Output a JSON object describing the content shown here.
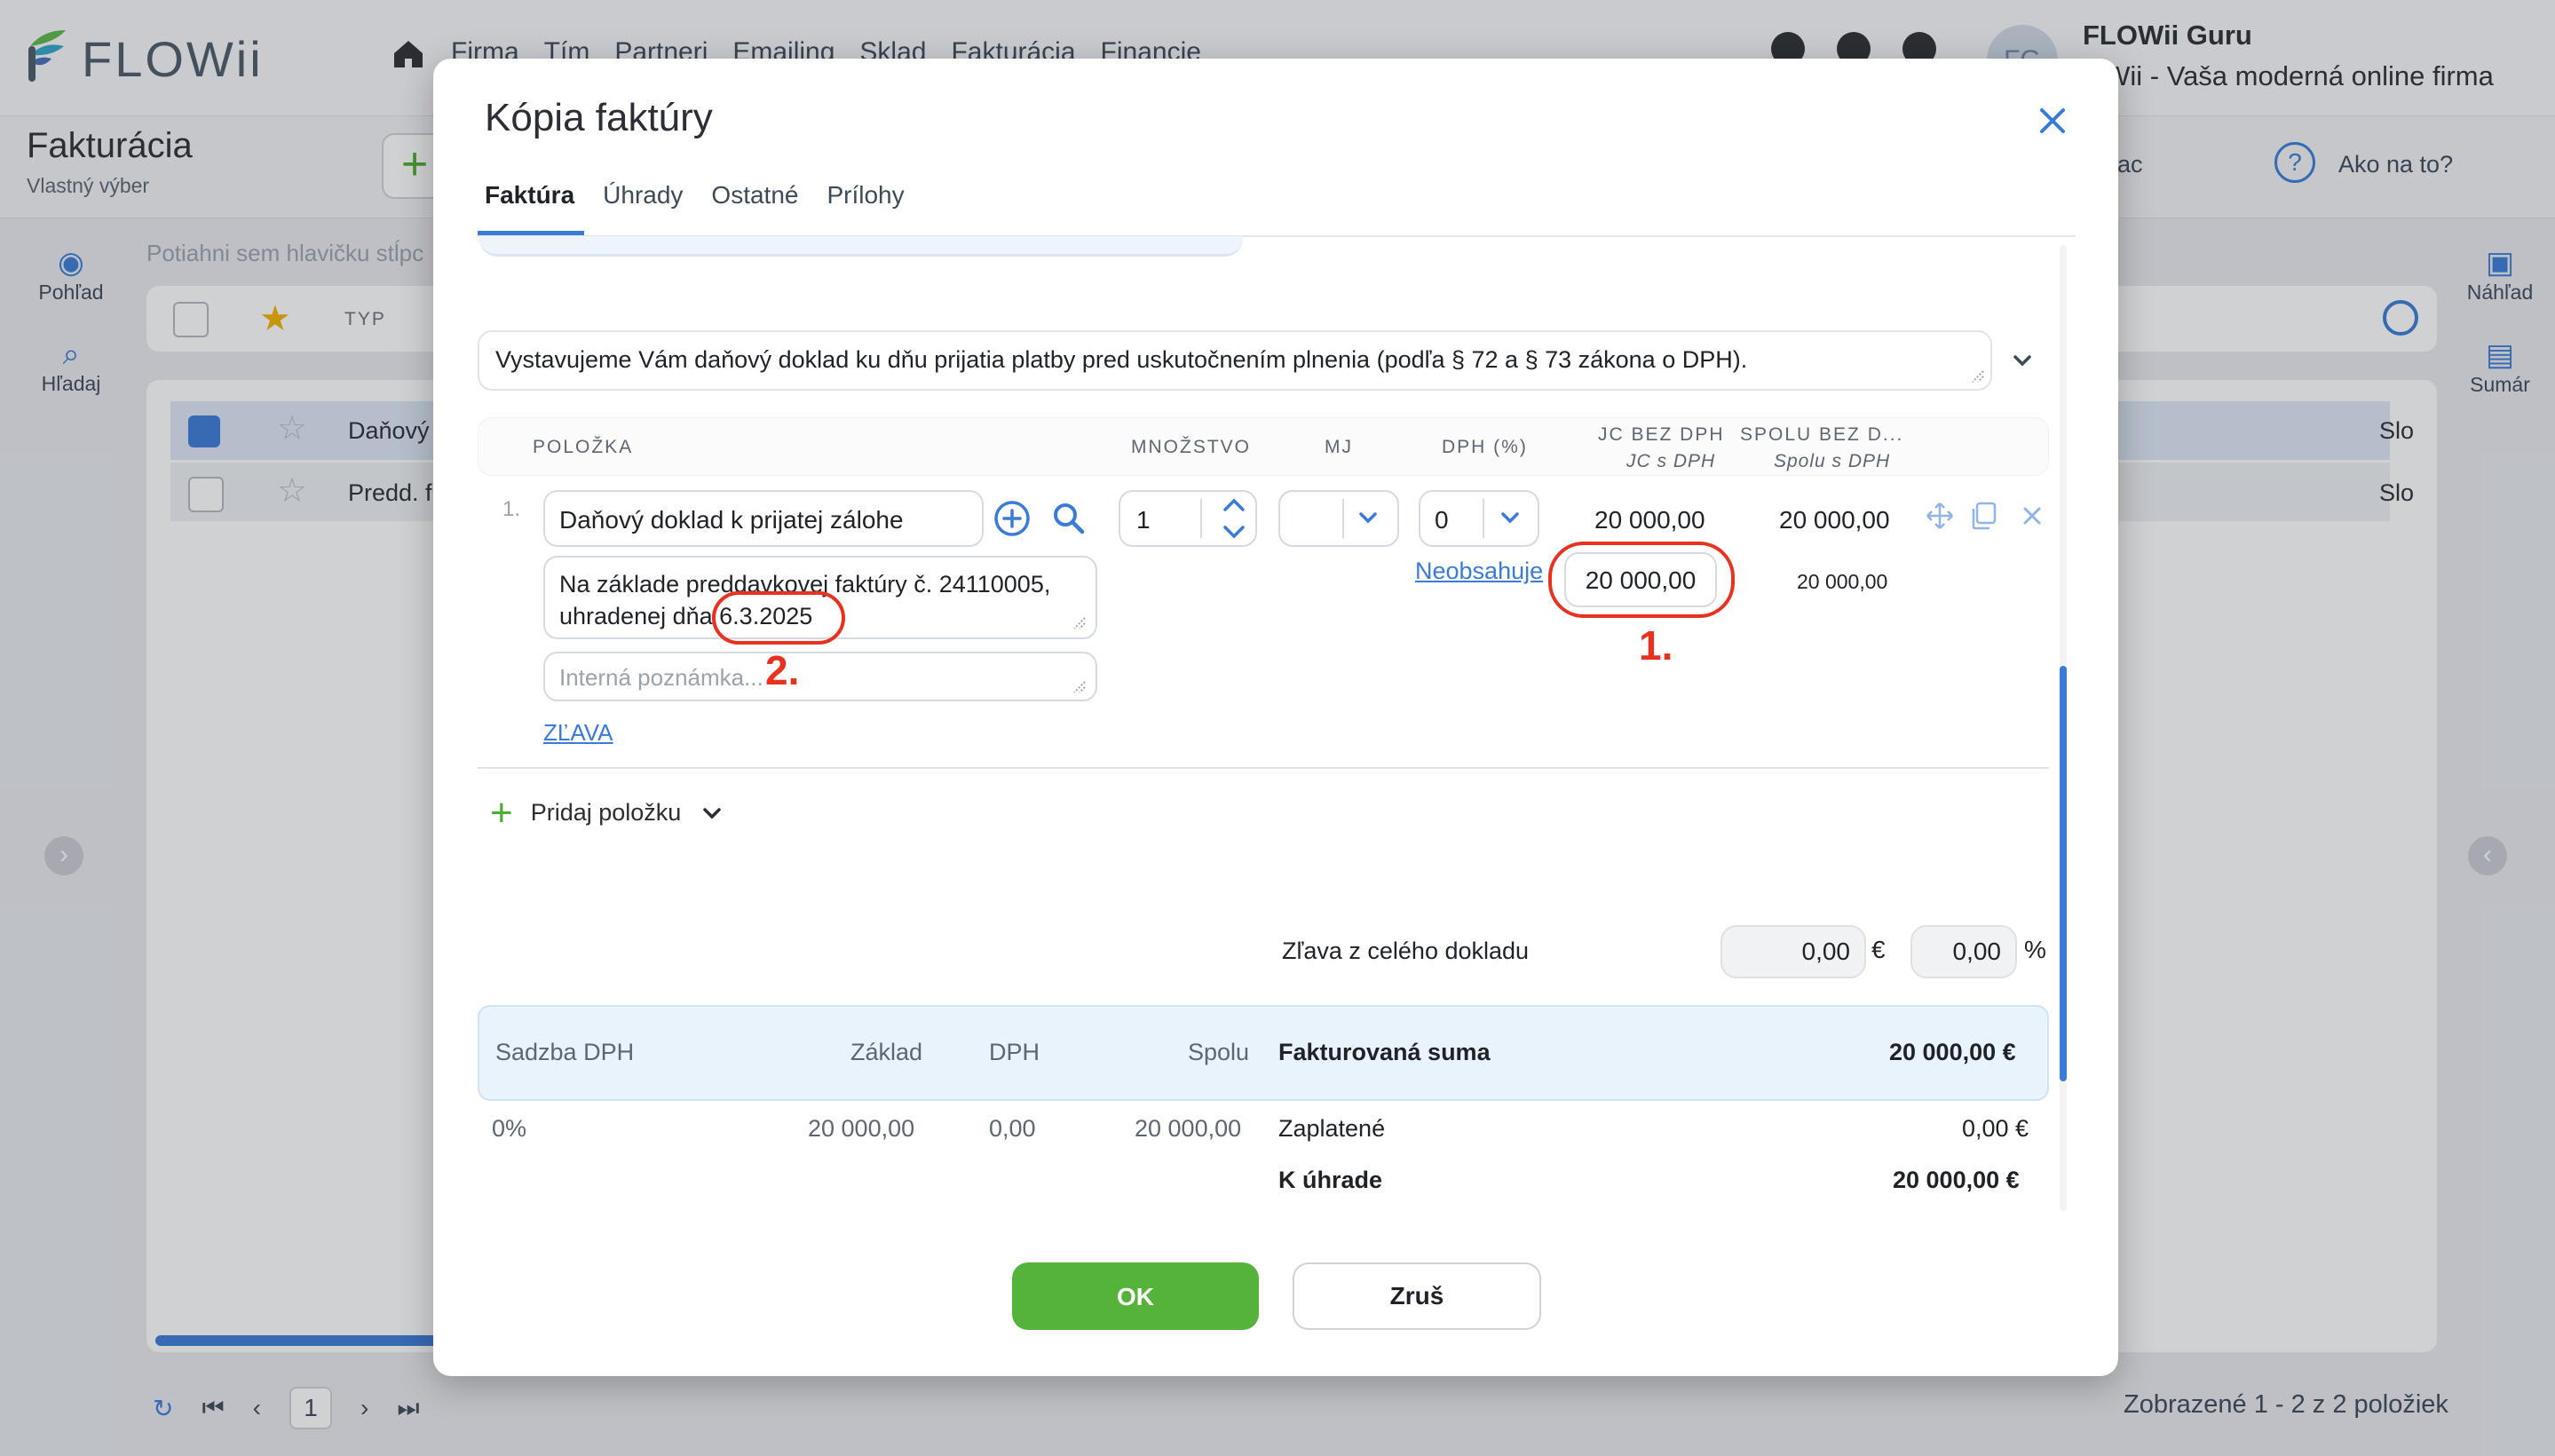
{
  "app": {
    "logo_text": "FLOWii",
    "nav": [
      "Firma",
      "Tím",
      "Partneri",
      "Emailing",
      "Sklad",
      "Fakturácia",
      "Financie"
    ],
    "user_initials": "FG",
    "user_name": "FLOWii Guru",
    "user_company": "OWii - Vaša moderná online firma"
  },
  "page": {
    "title": "Fakturácia",
    "subtitle": "Vlastný výber",
    "add_label": "+",
    "right_filter": "ac",
    "help_label": "Ako na to?",
    "help_icon_text": "?",
    "left_rail": [
      "Pohľad",
      "Hľadaj"
    ],
    "right_rail": [
      "Náhľad",
      "Sumár"
    ],
    "drop_hint": "Potiahni sem hlavičku stĺpc",
    "col_typ": "TYP",
    "rows": [
      {
        "label": "Daňový",
        "right": "Slo",
        "checked": true
      },
      {
        "label": "Predd. f",
        "right": "Slo",
        "checked": false
      }
    ],
    "pager_page": "1",
    "footer_count": "Zobrazené 1 - 2 z 2 položiek"
  },
  "modal": {
    "title": "Kópia faktúry",
    "tabs": [
      "Faktúra",
      "Úhrady",
      "Ostatné",
      "Prílohy"
    ],
    "active_tab": "Faktúra",
    "note": "Vystavujeme Vám daňový doklad ku dňu prijatia platby pred uskutočnením plnenia (podľa § 72 a § 73 zákona o DPH).",
    "headers": {
      "item": "POLOŽKA",
      "qty": "MNOŽSTVO",
      "mj": "MJ",
      "vat": "DPH (%)",
      "unit_price": "JC BEZ DPH",
      "unit_price_sub": "JC s DPH",
      "total": "SPOLU BEZ D...",
      "total_sub": "Spolu s DPH"
    },
    "item": {
      "number": "1.",
      "name": "Daňový doklad k prijatej zálohe",
      "qty": "1",
      "mj": "",
      "vat": "0",
      "unit_price": "20 000,00",
      "total": "20 000,00",
      "description_line1": "Na základe preddavkovej faktúry č. 24110005,",
      "description_line2": "uhradenej dňa 6.3.2025",
      "internal_placeholder": "Interná poznámka...",
      "discount_link": "ZĽAVA",
      "vat_note_link": "Neobsahuje",
      "unit_price_with_vat": "20 000,00",
      "total_with_vat": "20 000,00"
    },
    "annotations": {
      "one": "1.",
      "two": "2."
    },
    "add_item": "Pridaj položku",
    "discount": {
      "label": "Zľava z celého dokladu",
      "eur": "0,00",
      "eur_symbol": "€",
      "pct": "0,00",
      "pct_symbol": "%"
    },
    "summary": {
      "h_rate": "Sadzba DPH",
      "h_base": "Základ",
      "h_vat": "DPH",
      "h_total": "Spolu",
      "invoiced_label": "Fakturovaná suma",
      "invoiced_value": "20 000,00 €",
      "rate": "0%",
      "base": "20 000,00",
      "vat": "0,00",
      "total": "20 000,00",
      "paid_label": "Zaplatené",
      "paid_value": "0,00 €",
      "due_label": "K úhrade",
      "due_value": "20 000,00 €"
    },
    "ok": "OK",
    "cancel": "Zruš"
  }
}
